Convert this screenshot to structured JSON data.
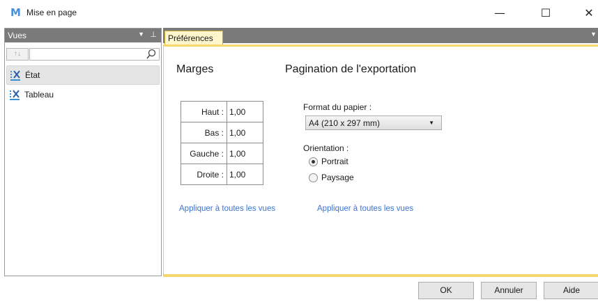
{
  "window": {
    "logo": "M",
    "title": "Mise en page",
    "minimize": "—",
    "maximize": "☐",
    "close": "✕"
  },
  "left_panel": {
    "title": "Vues",
    "items": [
      {
        "label": "État",
        "selected": true
      },
      {
        "label": "Tableau",
        "selected": false
      }
    ]
  },
  "tabs": [
    {
      "label": "Préférences",
      "active": true
    }
  ],
  "margins": {
    "title": "Marges",
    "rows": [
      {
        "label": "Haut :",
        "value": "1,00"
      },
      {
        "label": "Bas :",
        "value": "1,00"
      },
      {
        "label": "Gauche :",
        "value": "1,00"
      },
      {
        "label": "Droite :",
        "value": "1,00"
      }
    ],
    "apply_link": "Appliquer à toutes les vues"
  },
  "pagination": {
    "title": "Pagination de l'exportation",
    "paper_label": "Format du papier :",
    "paper_value": "A4 (210 x 297 mm)",
    "orientation_label": "Orientation :",
    "orientation_options": [
      {
        "label": "Portrait",
        "checked": true
      },
      {
        "label": "Paysage",
        "checked": false
      }
    ],
    "apply_link": "Appliquer à toutes les vues"
  },
  "buttons": {
    "ok": "OK",
    "cancel": "Annuler",
    "help": "Aide"
  },
  "colors": {
    "accent_yellow": "#f5d66b",
    "panel_header": "#7a7a7a",
    "link": "#3b73d1",
    "logo": "#4a90d9"
  }
}
